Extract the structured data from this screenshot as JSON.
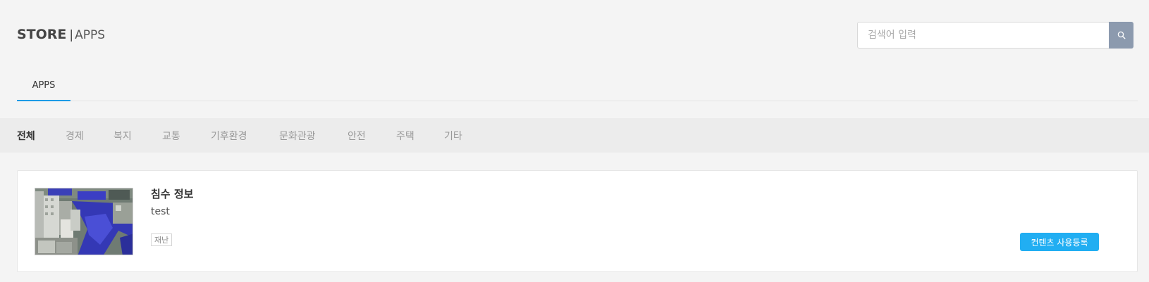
{
  "header": {
    "brand_store": "STORE",
    "brand_sep": "|",
    "brand_apps": "APPS"
  },
  "search": {
    "placeholder": "검색어 입력",
    "value": "",
    "icon": "search-icon"
  },
  "tabs": [
    {
      "label": "APPS",
      "active": true
    }
  ],
  "categories": [
    {
      "label": "전체",
      "active": true
    },
    {
      "label": "경제",
      "active": false
    },
    {
      "label": "복지",
      "active": false
    },
    {
      "label": "교통",
      "active": false
    },
    {
      "label": "기후환경",
      "active": false
    },
    {
      "label": "문화관광",
      "active": false
    },
    {
      "label": "안전",
      "active": false
    },
    {
      "label": "주택",
      "active": false
    },
    {
      "label": "기타",
      "active": false
    }
  ],
  "apps": [
    {
      "title": "침수 정보",
      "description": "test",
      "tag": "재난",
      "button_label": "컨텐츠 사용등록"
    }
  ],
  "colors": {
    "accent": "#1d9be6",
    "button": "#21aef2",
    "search_button": "#8c9aae"
  }
}
